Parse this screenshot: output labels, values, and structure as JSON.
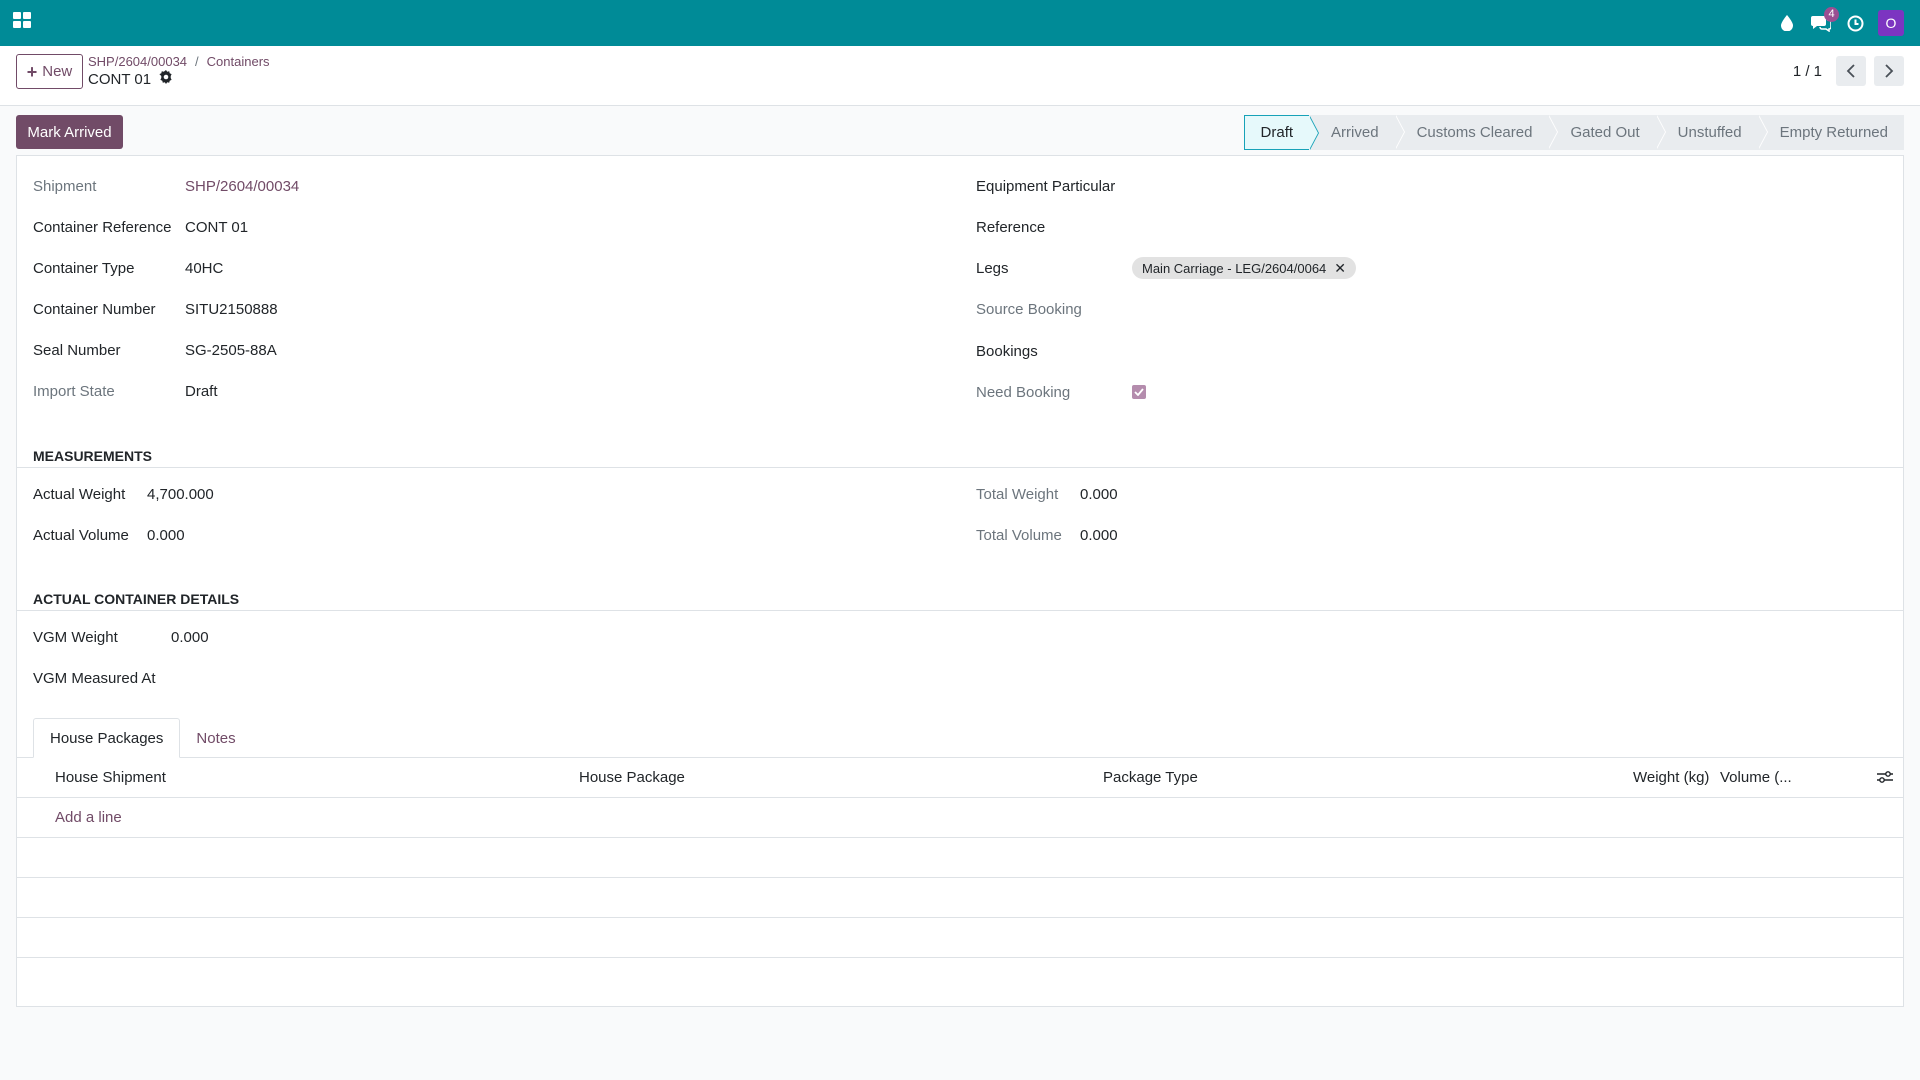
{
  "navbar": {
    "chat_badge": "4",
    "avatar_letter": "O"
  },
  "control_panel": {
    "new_label": "New",
    "breadcrumb": [
      "SHP/2604/00034",
      "Containers"
    ],
    "breadcrumb_sep": "/",
    "record_title": "CONT 01",
    "pager": "1 / 1"
  },
  "statusbar": {
    "mark_arrived_label": "Mark Arrived",
    "stages": [
      "Draft",
      "Arrived",
      "Customs Cleared",
      "Gated Out",
      "Unstuffed",
      "Empty Returned"
    ],
    "active_stage": "Draft"
  },
  "left_fields": [
    {
      "label": "Shipment",
      "value": "SHP/2604/00034"
    },
    {
      "label": "Container Reference",
      "value": "CONT 01"
    },
    {
      "label": "Container Type",
      "value": "40HC"
    },
    {
      "label": "Container Number",
      "value": "SITU2150888"
    },
    {
      "label": "Seal Number",
      "value": "SG-2505-88A"
    },
    {
      "label": "Import State",
      "value": "Draft"
    }
  ],
  "right_fields": {
    "equipment_particular": "Equipment Particular",
    "reference": "Reference",
    "legs": "Legs",
    "leg_tag": "Main Carriage - LEG/2604/0064",
    "source_booking": "Source Booking",
    "bookings": "Bookings",
    "need_booking": "Need Booking"
  },
  "measurements": {
    "title": "MEASUREMENTS",
    "actual_weight_label": "Actual Weight",
    "actual_weight": "4,700.000",
    "actual_volume_label": "Actual Volume",
    "actual_volume": "0.000",
    "total_weight_label": "Total Weight",
    "total_weight": "0.000",
    "total_volume_label": "Total Volume",
    "total_volume": "0.000"
  },
  "actual_details": {
    "title": "ACTUAL CONTAINER DETAILS",
    "vgm_weight_label": "VGM Weight",
    "vgm_weight": "0.000",
    "vgm_measured_label": "VGM Measured At"
  },
  "tabs": [
    "House Packages",
    "Notes"
  ],
  "table": {
    "columns": [
      "House Shipment",
      "House Package",
      "Package Type",
      "Weight (kg)",
      "Volume (..."
    ],
    "add_line": "Add a line"
  }
}
